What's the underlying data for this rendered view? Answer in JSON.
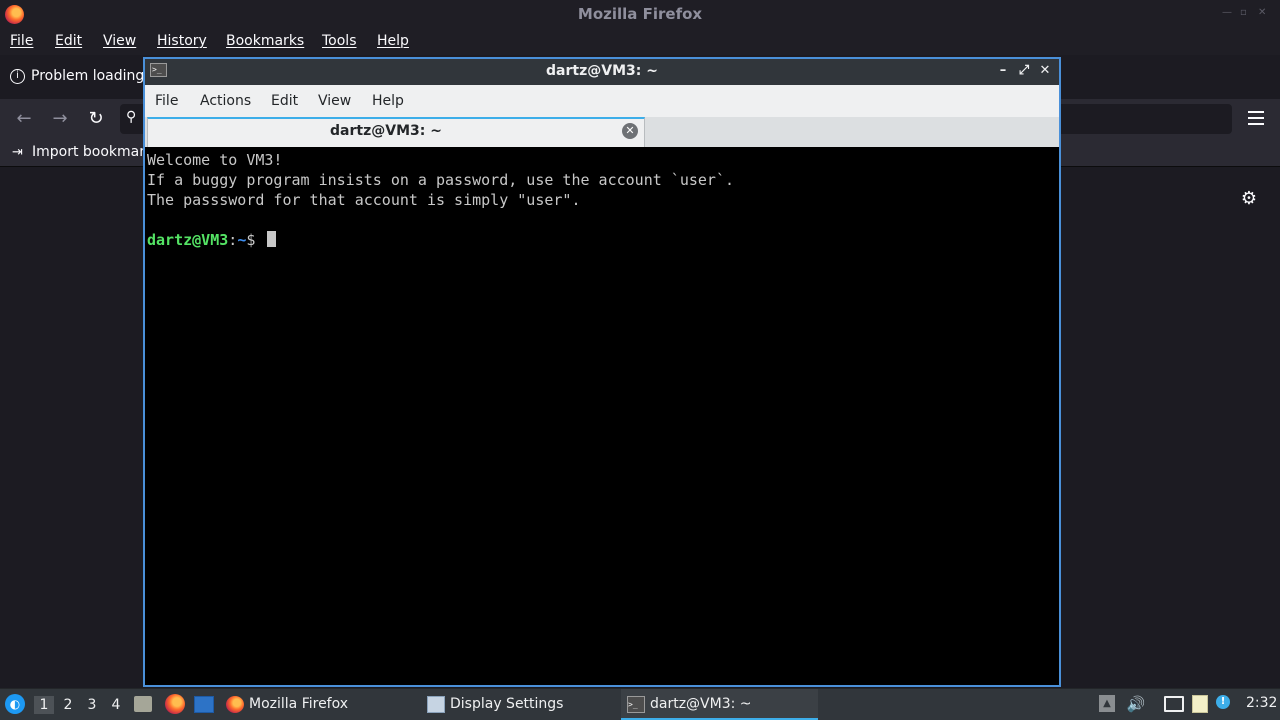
{
  "firefox": {
    "window_title": "Mozilla Firefox",
    "menu": [
      "File",
      "Edit",
      "View",
      "History",
      "Bookmarks",
      "Tools",
      "Help"
    ],
    "tab_title": "Problem loading page",
    "bookmarks_toolbar": {
      "import_label": "Import bookmarks..."
    },
    "icons": {
      "tab": "info-icon",
      "back": "back-arrow-icon",
      "forward": "forward-arrow-icon",
      "reload": "reload-icon",
      "search": "search-icon",
      "menu": "hamburger-menu-icon",
      "settings": "gear-icon"
    }
  },
  "terminal": {
    "window_title": "dartz@VM3: ~",
    "menu": [
      "File",
      "Actions",
      "Edit",
      "View",
      "Help"
    ],
    "tab_title": "dartz@VM3: ~",
    "lines": [
      "Welcome to VM3!",
      "If a buggy program insists on a password, use the account `user`.",
      "The passsword for that account is simply \"user\"."
    ],
    "prompt": {
      "user_host": "dartz@VM3",
      "colon": ":",
      "path": "~",
      "symbol": "$"
    },
    "colors": {
      "user_host": "#54e364",
      "path": "#3e8ef0",
      "accent": "#3daee9"
    }
  },
  "taskbar": {
    "workspaces": [
      "1",
      "2",
      "3",
      "4"
    ],
    "active_workspace": "1",
    "tasks": [
      {
        "label": "Mozilla Firefox",
        "icon": "firefox-icon"
      },
      {
        "label": "Display Settings",
        "icon": "display-settings-icon"
      },
      {
        "label": "dartz@VM3: ~",
        "icon": "terminal-icon"
      }
    ],
    "clock": "2:32"
  }
}
